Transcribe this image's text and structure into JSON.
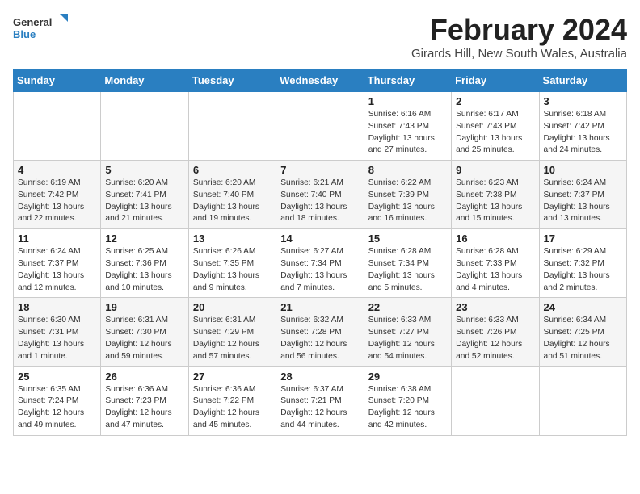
{
  "logo": {
    "text_general": "General",
    "text_blue": "Blue"
  },
  "title": "February 2024",
  "location": "Girards Hill, New South Wales, Australia",
  "days_of_week": [
    "Sunday",
    "Monday",
    "Tuesday",
    "Wednesday",
    "Thursday",
    "Friday",
    "Saturday"
  ],
  "weeks": [
    [
      {
        "day": "",
        "info": ""
      },
      {
        "day": "",
        "info": ""
      },
      {
        "day": "",
        "info": ""
      },
      {
        "day": "",
        "info": ""
      },
      {
        "day": "1",
        "info": "Sunrise: 6:16 AM\nSunset: 7:43 PM\nDaylight: 13 hours and 27 minutes."
      },
      {
        "day": "2",
        "info": "Sunrise: 6:17 AM\nSunset: 7:43 PM\nDaylight: 13 hours and 25 minutes."
      },
      {
        "day": "3",
        "info": "Sunrise: 6:18 AM\nSunset: 7:42 PM\nDaylight: 13 hours and 24 minutes."
      }
    ],
    [
      {
        "day": "4",
        "info": "Sunrise: 6:19 AM\nSunset: 7:42 PM\nDaylight: 13 hours and 22 minutes."
      },
      {
        "day": "5",
        "info": "Sunrise: 6:20 AM\nSunset: 7:41 PM\nDaylight: 13 hours and 21 minutes."
      },
      {
        "day": "6",
        "info": "Sunrise: 6:20 AM\nSunset: 7:40 PM\nDaylight: 13 hours and 19 minutes."
      },
      {
        "day": "7",
        "info": "Sunrise: 6:21 AM\nSunset: 7:40 PM\nDaylight: 13 hours and 18 minutes."
      },
      {
        "day": "8",
        "info": "Sunrise: 6:22 AM\nSunset: 7:39 PM\nDaylight: 13 hours and 16 minutes."
      },
      {
        "day": "9",
        "info": "Sunrise: 6:23 AM\nSunset: 7:38 PM\nDaylight: 13 hours and 15 minutes."
      },
      {
        "day": "10",
        "info": "Sunrise: 6:24 AM\nSunset: 7:37 PM\nDaylight: 13 hours and 13 minutes."
      }
    ],
    [
      {
        "day": "11",
        "info": "Sunrise: 6:24 AM\nSunset: 7:37 PM\nDaylight: 13 hours and 12 minutes."
      },
      {
        "day": "12",
        "info": "Sunrise: 6:25 AM\nSunset: 7:36 PM\nDaylight: 13 hours and 10 minutes."
      },
      {
        "day": "13",
        "info": "Sunrise: 6:26 AM\nSunset: 7:35 PM\nDaylight: 13 hours and 9 minutes."
      },
      {
        "day": "14",
        "info": "Sunrise: 6:27 AM\nSunset: 7:34 PM\nDaylight: 13 hours and 7 minutes."
      },
      {
        "day": "15",
        "info": "Sunrise: 6:28 AM\nSunset: 7:34 PM\nDaylight: 13 hours and 5 minutes."
      },
      {
        "day": "16",
        "info": "Sunrise: 6:28 AM\nSunset: 7:33 PM\nDaylight: 13 hours and 4 minutes."
      },
      {
        "day": "17",
        "info": "Sunrise: 6:29 AM\nSunset: 7:32 PM\nDaylight: 13 hours and 2 minutes."
      }
    ],
    [
      {
        "day": "18",
        "info": "Sunrise: 6:30 AM\nSunset: 7:31 PM\nDaylight: 13 hours and 1 minute."
      },
      {
        "day": "19",
        "info": "Sunrise: 6:31 AM\nSunset: 7:30 PM\nDaylight: 12 hours and 59 minutes."
      },
      {
        "day": "20",
        "info": "Sunrise: 6:31 AM\nSunset: 7:29 PM\nDaylight: 12 hours and 57 minutes."
      },
      {
        "day": "21",
        "info": "Sunrise: 6:32 AM\nSunset: 7:28 PM\nDaylight: 12 hours and 56 minutes."
      },
      {
        "day": "22",
        "info": "Sunrise: 6:33 AM\nSunset: 7:27 PM\nDaylight: 12 hours and 54 minutes."
      },
      {
        "day": "23",
        "info": "Sunrise: 6:33 AM\nSunset: 7:26 PM\nDaylight: 12 hours and 52 minutes."
      },
      {
        "day": "24",
        "info": "Sunrise: 6:34 AM\nSunset: 7:25 PM\nDaylight: 12 hours and 51 minutes."
      }
    ],
    [
      {
        "day": "25",
        "info": "Sunrise: 6:35 AM\nSunset: 7:24 PM\nDaylight: 12 hours and 49 minutes."
      },
      {
        "day": "26",
        "info": "Sunrise: 6:36 AM\nSunset: 7:23 PM\nDaylight: 12 hours and 47 minutes."
      },
      {
        "day": "27",
        "info": "Sunrise: 6:36 AM\nSunset: 7:22 PM\nDaylight: 12 hours and 45 minutes."
      },
      {
        "day": "28",
        "info": "Sunrise: 6:37 AM\nSunset: 7:21 PM\nDaylight: 12 hours and 44 minutes."
      },
      {
        "day": "29",
        "info": "Sunrise: 6:38 AM\nSunset: 7:20 PM\nDaylight: 12 hours and 42 minutes."
      },
      {
        "day": "",
        "info": ""
      },
      {
        "day": "",
        "info": ""
      }
    ]
  ]
}
